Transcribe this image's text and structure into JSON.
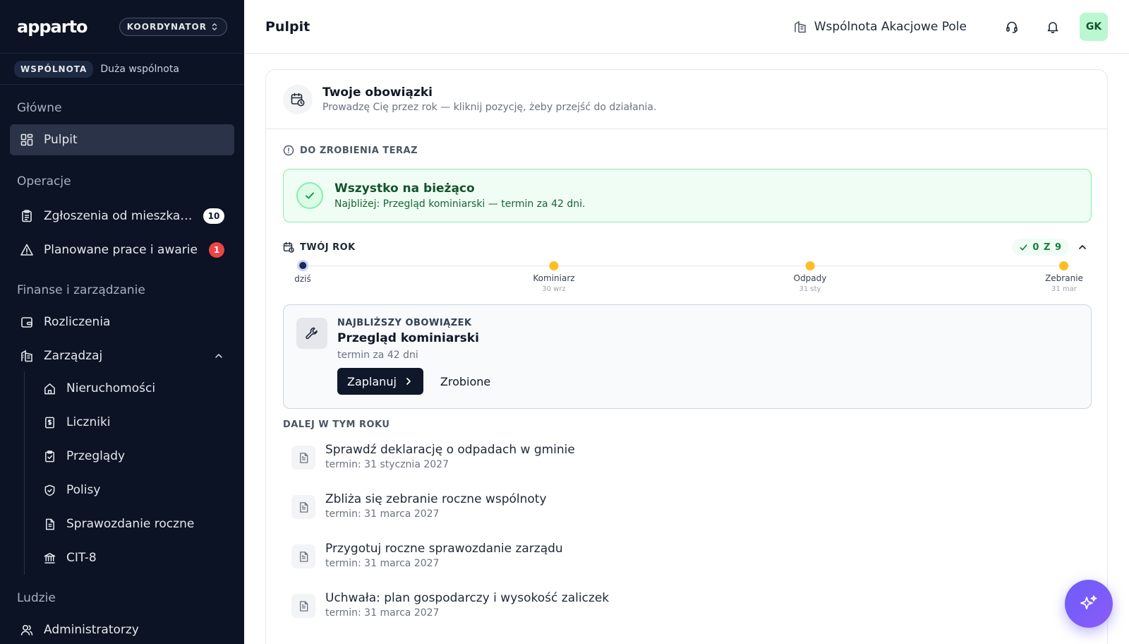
{
  "sidebar": {
    "logo": "apparto",
    "role": "KOORDYNATOR",
    "community_badge": "WSPÓLNOTA",
    "community_type": "Duża wspólnota",
    "sections": {
      "main": "Główne",
      "operations": "Operacje",
      "finance": "Finanse i zarządzanie",
      "people": "Ludzie"
    },
    "items": {
      "dashboard": "Pulpit",
      "reports": "Zgłoszenia od mieszkańców",
      "reports_count": "10",
      "planned": "Planowane prace i awarie",
      "planned_count": "1",
      "settlements": "Rozliczenia",
      "manage": "Zarządzaj",
      "properties": "Nieruchomości",
      "meters": "Liczniki",
      "inspections": "Przeglądy",
      "policies": "Polisy",
      "annual_report": "Sprawozdanie roczne",
      "cit8": "CIT-8",
      "admins": "Administratorzy"
    }
  },
  "header": {
    "title": "Pulpit",
    "community": "Wspólnota Akacjowe Pole",
    "avatar": "GK"
  },
  "duties": {
    "title": "Twoje obowiązki",
    "subtitle": "Prowadzę Cię przez rok — kliknij pozycję, żeby przejść do działania.",
    "todo_label": "DO ZROBIENIA TERAZ",
    "ok_title": "Wszystko na bieżąco",
    "ok_subtitle": "Najbliżej: Przegląd kominiarski — termin za 42 dni.",
    "year_label": "TWÓJ ROK",
    "progress": "0 Z 9",
    "timeline": {
      "today": "dziś",
      "p1_name": "Kominiarz",
      "p1_date": "30 wrz",
      "p2_name": "Odpady",
      "p2_date": "31 sty",
      "p3_name": "Zebranie",
      "p3_date": "31 mar"
    },
    "next": {
      "eyebrow": "NAJBLIŻSZY OBOWIĄZEK",
      "title": "Przegląd kominiarski",
      "subtitle": "termin za 42 dni",
      "plan_btn": "Zaplanuj",
      "done_btn": "Zrobione"
    },
    "later_label": "DALEJ W TYM ROKU",
    "later": [
      {
        "title": "Sprawdź deklarację o odpadach w gminie",
        "due": "termin: 31 stycznia 2027"
      },
      {
        "title": "Zbliża się zebranie roczne wspólnoty",
        "due": "termin: 31 marca 2027"
      },
      {
        "title": "Przygotuj roczne sprawozdanie zarządu",
        "due": "termin: 31 marca 2027"
      },
      {
        "title": "Uchwała: plan gospodarczy i wysokość zaliczek",
        "due": "termin: 31 marca 2027"
      }
    ]
  },
  "colors": {
    "sidebar_bg": "#0b1325",
    "accent_green": "#86efac",
    "timeline_dot": "#fbbf24",
    "fab": "#6d5dfc"
  }
}
